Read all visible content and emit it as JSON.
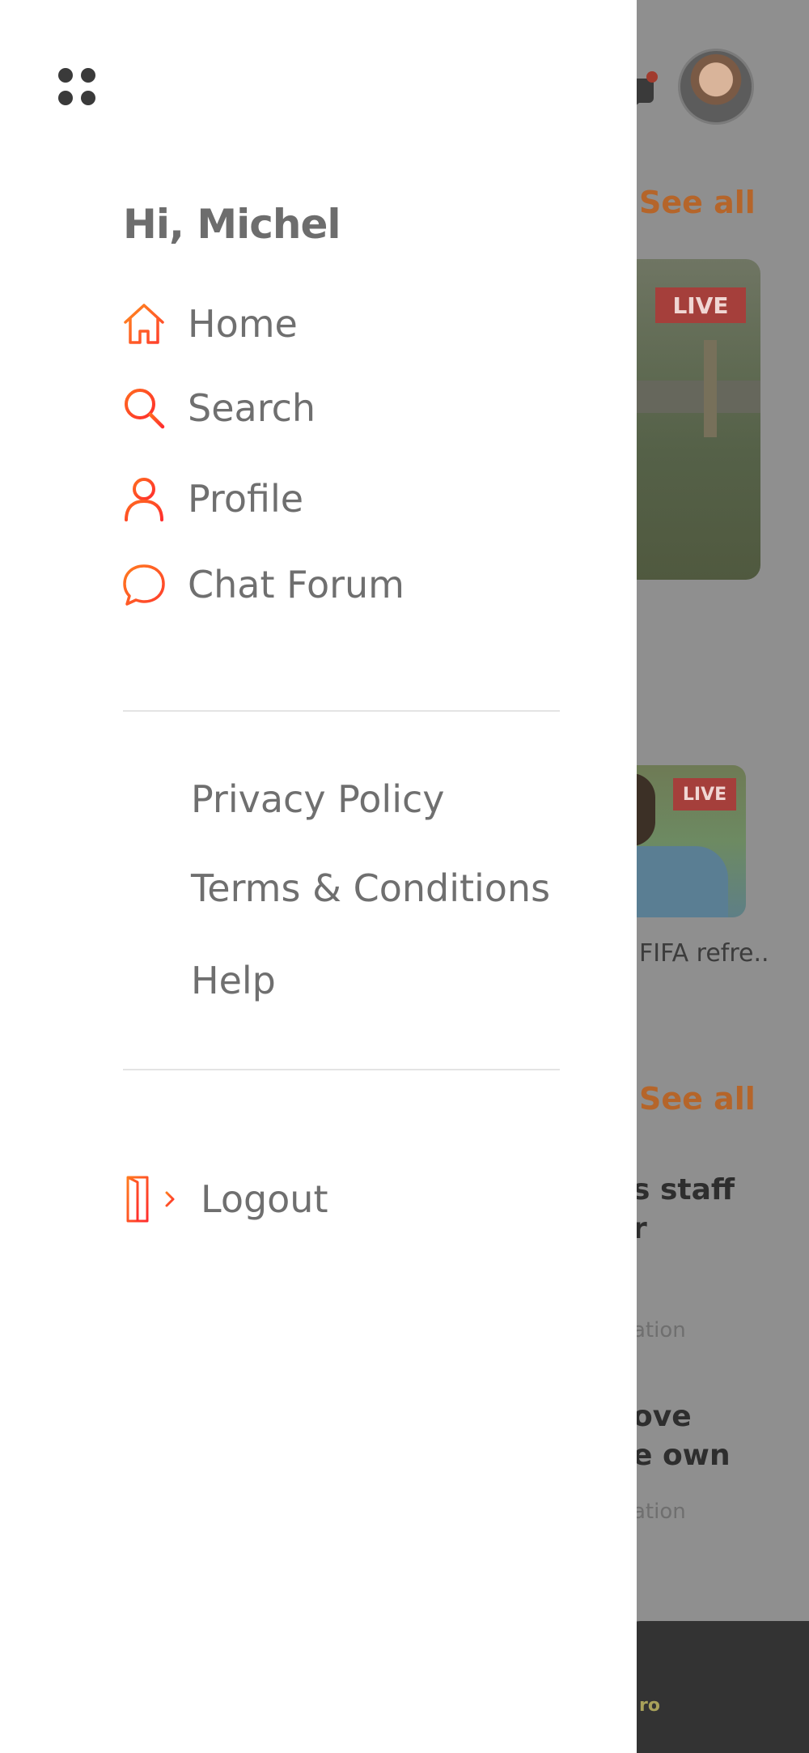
{
  "drawer": {
    "greeting": "Hi, Michel",
    "menu": [
      {
        "label": "Home",
        "icon": "home-icon"
      },
      {
        "label": "Search",
        "icon": "search-icon"
      },
      {
        "label": "Profile",
        "icon": "profile-icon"
      },
      {
        "label": "Chat Forum",
        "icon": "chat-icon"
      }
    ],
    "links": [
      {
        "label": "Privacy Policy"
      },
      {
        "label": "Terms & Conditions"
      },
      {
        "label": "Help"
      }
    ],
    "logout": {
      "label": "Logout",
      "icon": "logout-icon"
    },
    "accent_color": "#ff6a1f",
    "accent_color_2": "#ff2d2d"
  },
  "background": {
    "see_all_1": "See all",
    "see_all_2": "See all",
    "live_badge_1": "LIVE",
    "live_badge_2": "LIVE",
    "caption": "FIFA refre..",
    "news_1": [
      "s staff",
      "r"
    ],
    "news_1_sub": "ation",
    "news_2": [
      "ove",
      "e own"
    ],
    "news_2_sub": "ation",
    "bottom_bar_text": "ro"
  }
}
